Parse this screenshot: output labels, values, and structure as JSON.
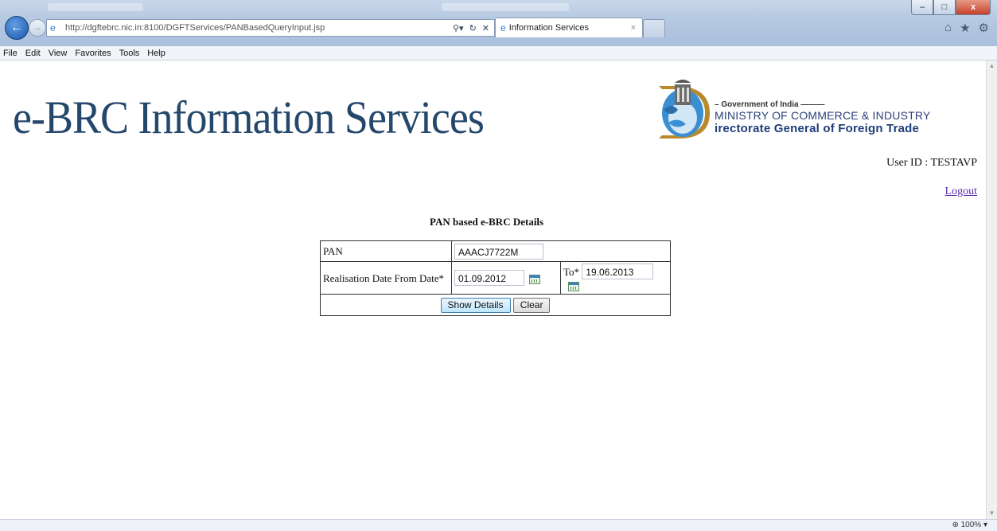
{
  "browser": {
    "address_url": "http://dgftebrc.nic.in:8100/DGFTServices/PANBasedQueryInput.jsp",
    "tab_title": "Information Services",
    "menu": [
      "File",
      "Edit",
      "View",
      "Favorites",
      "Tools",
      "Help"
    ],
    "zoom": "100%"
  },
  "header": {
    "title": "e-BRC Information Services",
    "logo": {
      "line1": "– Government of India ———",
      "line2": "MINISTRY OF COMMERCE & INDUSTRY",
      "line3": "irectorate General of Foreign Trade"
    },
    "user_id": "User ID : TESTAVP",
    "logout": "Logout"
  },
  "form": {
    "title": "PAN based e-BRC Details",
    "pan_label": "PAN",
    "pan_value": "AAACJ7722M",
    "from_label": "Realisation Date From Date*",
    "from_value": "01.09.2012",
    "to_label": "To*",
    "to_value": "19.06.2013",
    "show_label": "Show Details",
    "clear_label": "Clear"
  },
  "colors": {
    "title_blue": "#24486b",
    "link_purple": "#5a2aa8",
    "chrome_blue": "#b6c9e2"
  },
  "icons": [
    "back-icon",
    "forward-icon",
    "ie-icon",
    "search-icon",
    "refresh-icon",
    "stop-icon",
    "home-icon",
    "star-icon",
    "gear-icon",
    "calendar-icon"
  ]
}
